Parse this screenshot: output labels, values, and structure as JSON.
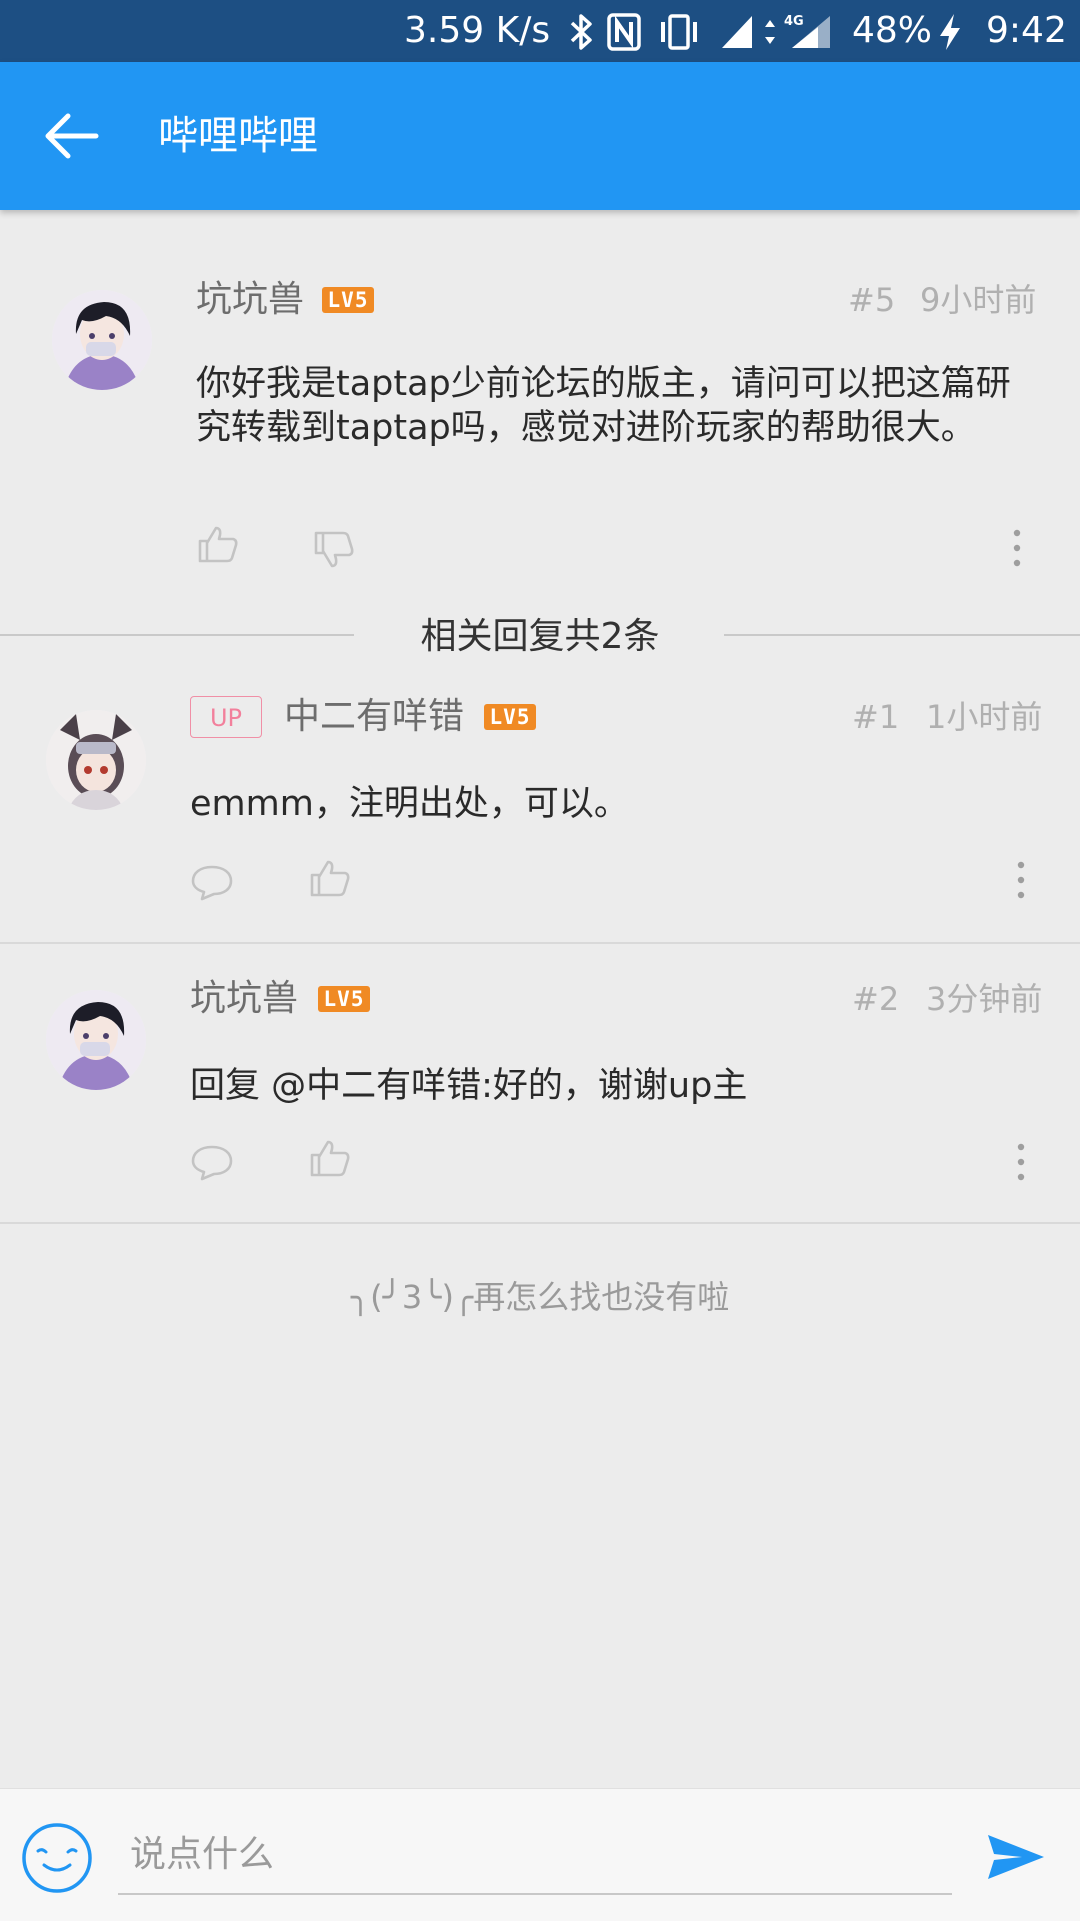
{
  "status_bar": {
    "net_speed": "3.59 K/s",
    "battery": "48%",
    "time": "9:42",
    "network_type": "4G",
    "icons": [
      "bluetooth-icon",
      "nfc-icon",
      "vibrate-icon",
      "signal-icon",
      "data-arrows-icon",
      "signal-4g-icon",
      "charging-icon"
    ]
  },
  "app_bar": {
    "title": "哔哩哔哩",
    "back_icon": "arrow-left-icon"
  },
  "main_comment": {
    "username": "坑坑兽",
    "level": "LV5",
    "floor": "#5",
    "time": "9小时前",
    "text": "你好我是taptap少前论坛的版主，请问可以把这篇研究转载到taptap吗，感觉对进阶玩家的帮助很大。"
  },
  "replies_header": "相关回复共2条",
  "replies": [
    {
      "badge": "UP",
      "username": "中二有咩错",
      "level": "LV5",
      "floor": "#1",
      "time": "1小时前",
      "text": "emmm，注明出处，可以。"
    },
    {
      "username": "坑坑兽",
      "level": "LV5",
      "floor": "#2",
      "time": "3分钟前",
      "text": "回复 @中二有咩错:好的，谢谢up主"
    }
  ],
  "end_text": "╮(╯3╰)╭再怎么找也没有啦",
  "compose": {
    "placeholder": "说点什么",
    "value": ""
  },
  "colors": {
    "app_bar": "#2196f3",
    "status_bar": "#1d4f83",
    "level_badge": "#f08a24",
    "up_badge": "#f2809c",
    "send": "#2196f3"
  }
}
